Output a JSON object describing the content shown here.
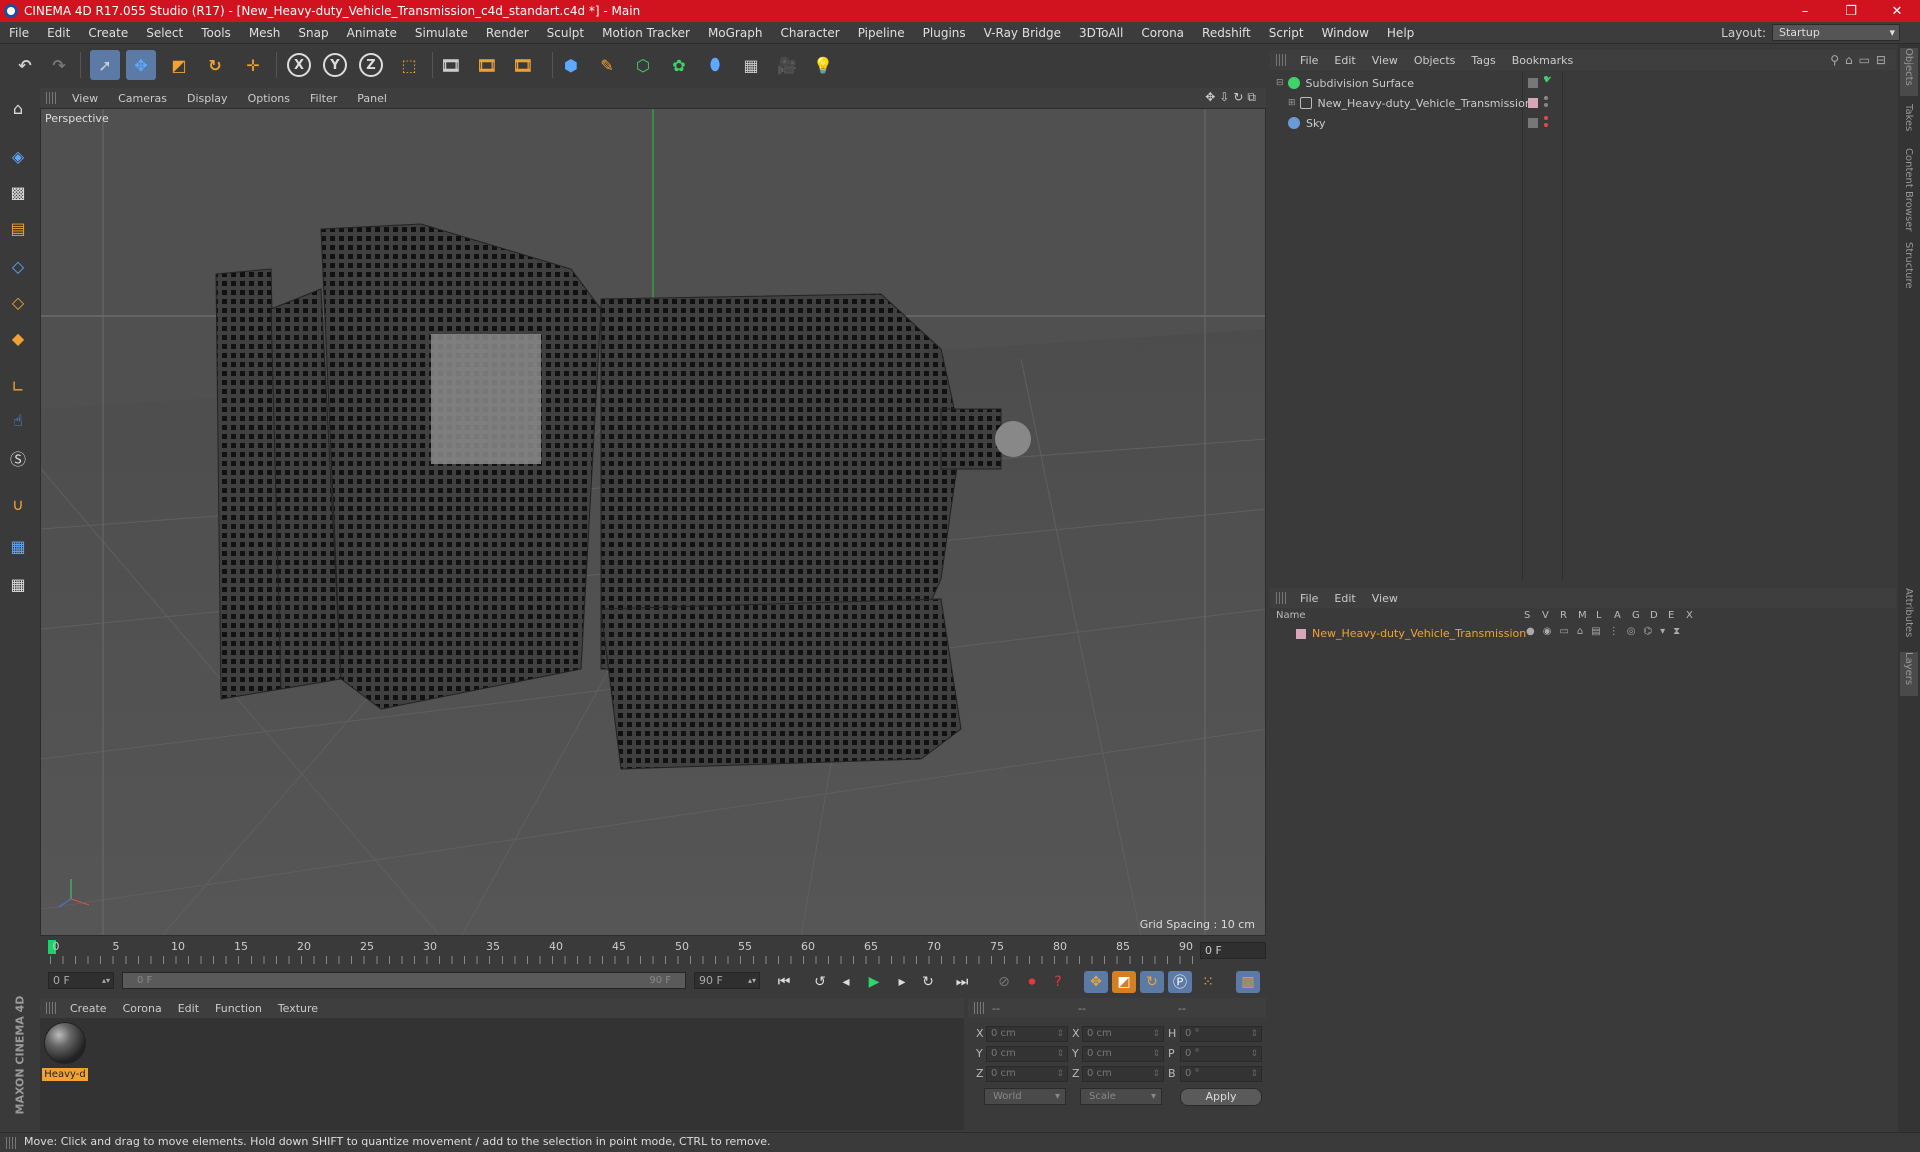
{
  "titlebar": {
    "title": "CINEMA 4D R17.055 Studio (R17) - [New_Heavy-duty_Vehicle_Transmission_c4d_standart.c4d *] - Main",
    "minimize": "–",
    "restore": "❐",
    "close": "✕"
  },
  "menubar": {
    "items": [
      "File",
      "Edit",
      "Create",
      "Select",
      "Tools",
      "Mesh",
      "Snap",
      "Animate",
      "Simulate",
      "Render",
      "Sculpt",
      "Motion Tracker",
      "MoGraph",
      "Character",
      "Pipeline",
      "Plugins",
      "V-Ray Bridge",
      "3DToAll",
      "Corona",
      "Redshift",
      "Script",
      "Window",
      "Help"
    ],
    "layout_label": "Layout:",
    "layout_value": "Startup"
  },
  "toolbar": {
    "x_axis": "X",
    "y_axis": "Y",
    "z_axis": "Z"
  },
  "viewport": {
    "menu": [
      "View",
      "Cameras",
      "Display",
      "Options",
      "Filter",
      "Panel"
    ],
    "label": "Perspective",
    "grid_spacing": "Grid Spacing : 10 cm"
  },
  "timeline": {
    "ticks": [
      "0",
      "5",
      "10",
      "15",
      "20",
      "25",
      "30",
      "35",
      "40",
      "45",
      "50",
      "55",
      "60",
      "65",
      "70",
      "75",
      "80",
      "85",
      "90"
    ],
    "current_frame": "0 F"
  },
  "transport": {
    "start_field": "0 F",
    "range_start": "0 F",
    "range_end": "90 F",
    "end_field": "90 F"
  },
  "material_manager": {
    "menu": [
      "Create",
      "Corona",
      "Edit",
      "Function",
      "Texture"
    ],
    "material_name": "Heavy-d"
  },
  "coordinates": {
    "header_1": "--",
    "header_2": "--",
    "header_3": "--",
    "rows": [
      {
        "l1": "X",
        "v1": "0 cm",
        "l2": "X",
        "v2": "0 cm",
        "l3": "H",
        "v3": "0 °"
      },
      {
        "l1": "Y",
        "v1": "0 cm",
        "l2": "Y",
        "v2": "0 cm",
        "l3": "P",
        "v3": "0 °"
      },
      {
        "l1": "Z",
        "v1": "0 cm",
        "l2": "Z",
        "v2": "0 cm",
        "l3": "B",
        "v3": "0 °"
      }
    ],
    "mode": "World",
    "type": "Scale",
    "apply": "Apply"
  },
  "object_manager": {
    "menu": [
      "File",
      "Edit",
      "View",
      "Objects",
      "Tags",
      "Bookmarks"
    ],
    "objects": [
      {
        "name": "Subdivision Surface"
      },
      {
        "name": "New_Heavy-duty_Vehicle_Transmission"
      },
      {
        "name": "Sky"
      }
    ]
  },
  "layer_manager": {
    "menu": [
      "File",
      "Edit",
      "View"
    ],
    "columns": [
      "Name",
      "S",
      "V",
      "R",
      "M",
      "L",
      "A",
      "G",
      "D",
      "E",
      "X"
    ],
    "layer_name": "New_Heavy-duty_Vehicle_Transmission"
  },
  "side_tabs": [
    "Objects",
    "Takes",
    "Content Browser",
    "Structure",
    "Attributes",
    "Layers"
  ],
  "brand": "MAXON CINEMA 4D",
  "statusbar": {
    "text": "Move: Click and drag to move elements. Hold down SHIFT to quantize movement / add to the selection in point mode, CTRL to remove."
  },
  "colors": {
    "titlebar": "#d0131f",
    "accent_selection": "#5b7ba6",
    "highlight_orange": "#f2a232",
    "playhead_green": "#1fcf6b"
  }
}
